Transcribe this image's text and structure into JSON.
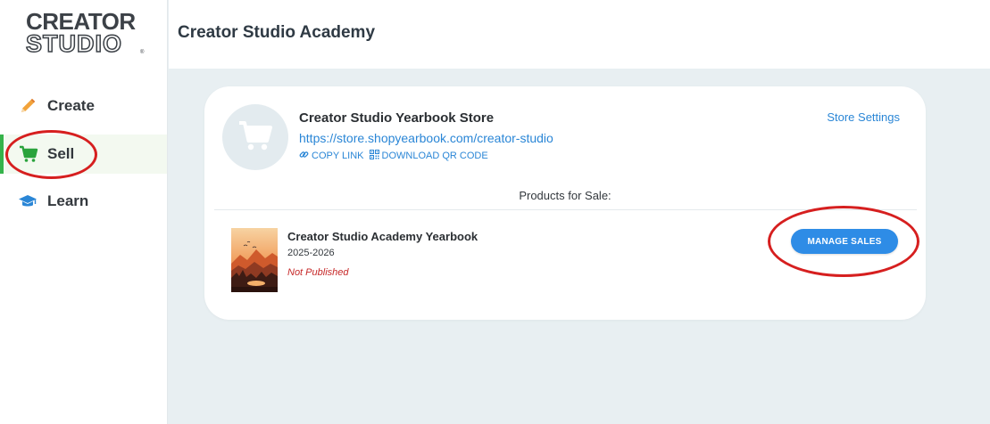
{
  "logo": {
    "line1": "CREATOR",
    "line2": "STUDIO",
    "tm": "®"
  },
  "sidebar": {
    "items": [
      {
        "label": "Create",
        "icon": "pencil-icon"
      },
      {
        "label": "Sell",
        "icon": "cart-icon",
        "active": true
      },
      {
        "label": "Learn",
        "icon": "graduation-cap-icon"
      }
    ]
  },
  "header": {
    "title": "Creator Studio Academy"
  },
  "store": {
    "name": "Creator Studio Yearbook Store",
    "url": "https://store.shopyearbook.com/creator-studio",
    "copy_link": "COPY LINK",
    "download_qr": "DOWNLOAD QR CODE",
    "settings": "Store Settings",
    "products_heading": "Products for Sale:"
  },
  "product": {
    "title": "Creator Studio Academy Yearbook",
    "year": "2025-2026",
    "status": "Not Published",
    "manage_label": "MANAGE SALES"
  },
  "colors": {
    "accent_blue": "#2e8ce6",
    "active_green": "#35b34a",
    "status_red": "#c62828",
    "annotation_red": "#d61f1f",
    "background": "#e8eff2"
  }
}
